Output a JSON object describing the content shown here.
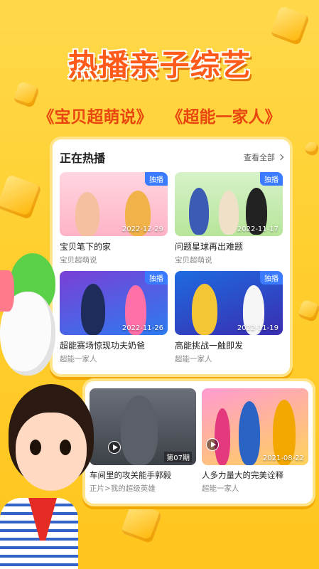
{
  "headline": "热播亲子综艺",
  "subtitle": {
    "left": "《宝贝超萌说》",
    "right": "《超能一家人》"
  },
  "panel": {
    "title": "正在热播",
    "see_all": "查看全部",
    "cards": [
      {
        "title": "宝贝笔下的家",
        "subtitle": "宝贝超萌说",
        "badge": "独播",
        "date": "2022-12-29"
      },
      {
        "title": "问题星球再出难题",
        "subtitle": "宝贝超萌说",
        "badge": "独播",
        "date": "2022-11-17"
      },
      {
        "title": "超能赛场惊现功夫奶爸",
        "subtitle": "超能一家人",
        "badge": "独播",
        "date": "2022-11-26"
      },
      {
        "title": "高能挑战一触即发",
        "subtitle": "超能一家人",
        "badge": "独播",
        "date": "2022-11-19"
      }
    ]
  },
  "strip": {
    "cards": [
      {
        "title": "车间里的攻关能手郭毅",
        "subtitle": "正片>我的超级英雄",
        "episode": "第07期"
      },
      {
        "title": "人多力量大的完美诠释",
        "subtitle": "超能一家人",
        "date": "2021-08-22"
      }
    ]
  },
  "colors": {
    "background": "#ffcf2f",
    "headline": "#ff5a1a",
    "badge": "#3b7bff"
  }
}
